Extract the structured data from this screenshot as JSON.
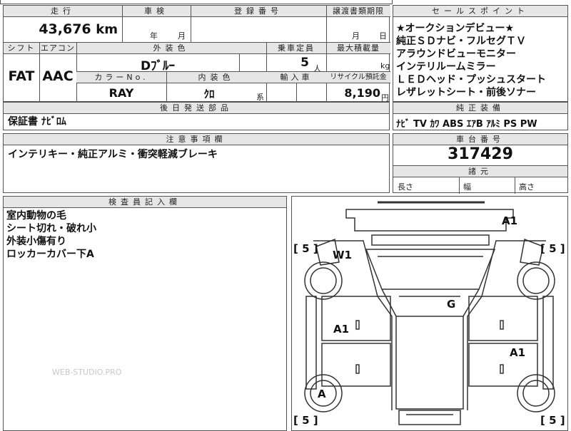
{
  "top_strip": {
    "partial": "..."
  },
  "mileage": {
    "header": "走行",
    "value": "43,676",
    "unit": "km"
  },
  "inspection": {
    "header": "車検",
    "year_label": "年",
    "month_label": "月"
  },
  "registration": {
    "header": "登録番号"
  },
  "transfer_deadline": {
    "header": "譲渡書類期限",
    "month_label": "月",
    "day_label": "日"
  },
  "selling_points": {
    "header": "セールスポイント",
    "lines": [
      "★オークションデビュー★",
      "純正ＳＤナビ・フルセグＴＶ",
      "アラウンドビューモニター",
      "インテリルームミラー",
      "ＬＥＤヘッド・プッシュスタート",
      "レザレットシート・前後ソナー"
    ]
  },
  "shift": {
    "header": "シフト",
    "value": "FAT"
  },
  "aircon": {
    "header": "エアコン",
    "value": "AAC"
  },
  "exterior_color": {
    "header": "外装色",
    "value": "Dﾌﾞﾙｰ"
  },
  "capacity": {
    "header": "乗車定員",
    "value": "5",
    "unit": "人"
  },
  "max_load": {
    "header": "最大積載量",
    "unit": "kg"
  },
  "color_no": {
    "header": "カラーNo.",
    "value": "RAY"
  },
  "interior_color": {
    "header": "内装色",
    "value": "ｸﾛ",
    "suffix": "系"
  },
  "import": {
    "header": "輸入車"
  },
  "recycle": {
    "header": "リサイクル預託金",
    "value": "8,190",
    "unit": "円"
  },
  "later_parts": {
    "header": "後日発送部品",
    "value": "保証書 ﾅﾋﾞﾛﾑ"
  },
  "standard_equipment": {
    "header": "純正装備",
    "value": "ﾅﾋﾞ TV ｶﾜ ABS ｴｱB ｱﾙﾐ PS PW"
  },
  "notes": {
    "header": "注意事項欄",
    "value": "インテリキー・純正アルミ・衝突軽減ブレーキ"
  },
  "chassis": {
    "header": "車台番号",
    "value": "317429"
  },
  "dimensions": {
    "header": "諸元",
    "length": "長さ",
    "width": "幅",
    "height": "高さ"
  },
  "inspector": {
    "header": "検査員記入欄",
    "lines": [
      "室内動物の毛",
      "シート切れ・破れ小",
      "外装小傷有り",
      "ロッカーカバー下A"
    ]
  },
  "diagram": {
    "marks": {
      "a1_top_right": "A1",
      "w1": "W1",
      "g": "G",
      "a1_left": "A1",
      "a1_right": "A1",
      "a_bottom_left": "A"
    },
    "tires": {
      "front_left": "5",
      "front_right": "5",
      "rear_left": "5",
      "rear_right": "5"
    }
  },
  "watermark": "WEB-STUDIO.PRO"
}
